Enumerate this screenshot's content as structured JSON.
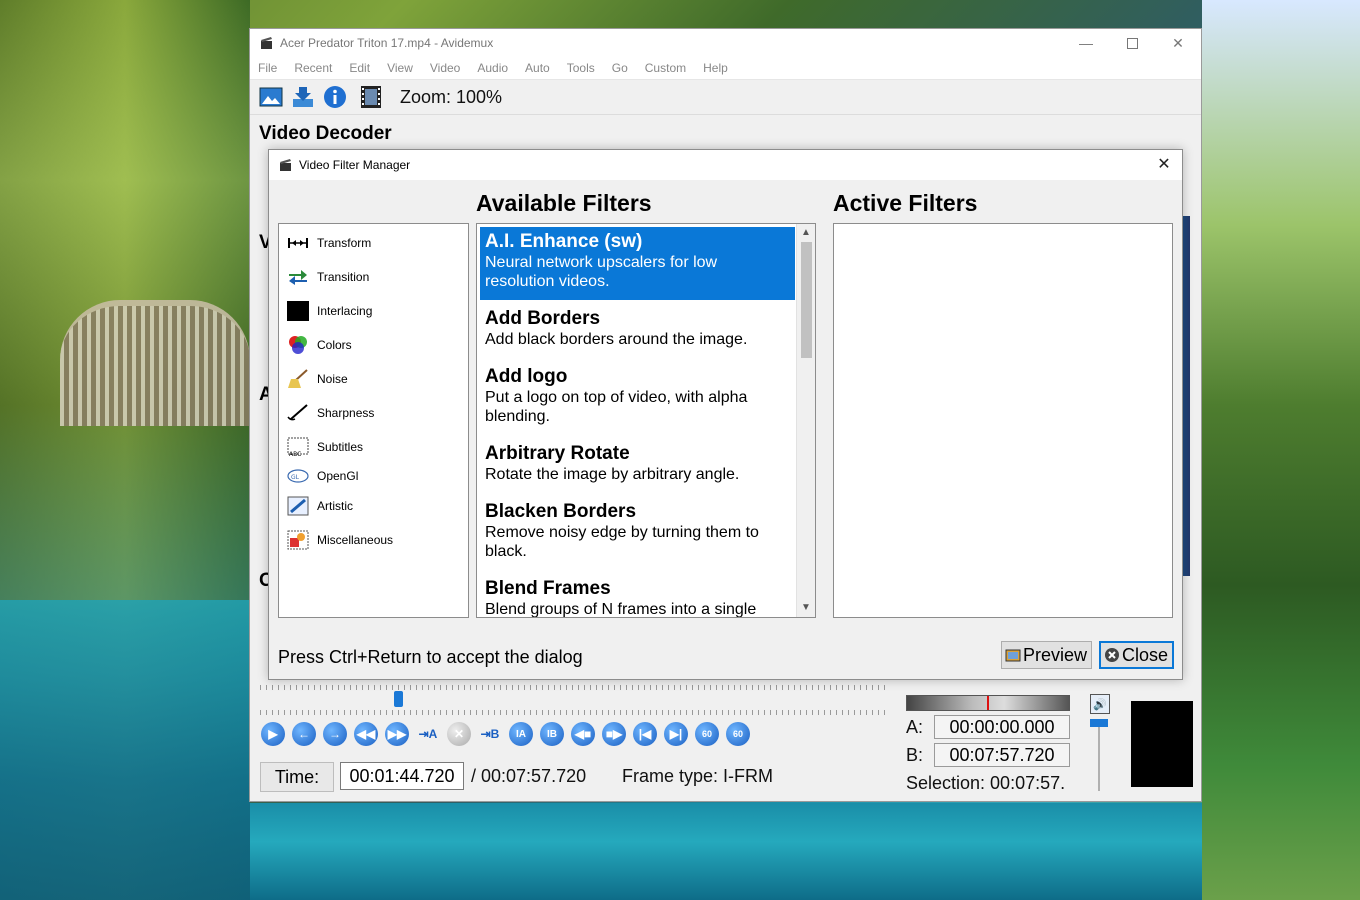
{
  "window": {
    "title": "Acer Predator Triton 17.mp4 - Avidemux",
    "menu": [
      "File",
      "Recent",
      "Edit",
      "View",
      "Video",
      "Audio",
      "Auto",
      "Tools",
      "Go",
      "Custom",
      "Help"
    ],
    "zoom": "Zoom: 100%",
    "section_title": "Video Decoder",
    "side_letters": [
      "V",
      "A",
      "O"
    ]
  },
  "dialog": {
    "title": "Video Filter Manager",
    "available_heading": "Available Filters",
    "active_heading": "Active Filters",
    "categories": [
      {
        "label": "Transform",
        "icon": "transform-icon"
      },
      {
        "label": "Transition",
        "icon": "transition-icon"
      },
      {
        "label": "Interlacing",
        "icon": "interlacing-icon"
      },
      {
        "label": "Colors",
        "icon": "colors-icon"
      },
      {
        "label": "Noise",
        "icon": "noise-icon"
      },
      {
        "label": "Sharpness",
        "icon": "sharpness-icon"
      },
      {
        "label": "Subtitles",
        "icon": "subtitles-icon"
      },
      {
        "label": "OpenGl",
        "icon": "opengl-icon"
      },
      {
        "label": "Artistic",
        "icon": "artistic-icon"
      },
      {
        "label": "Miscellaneous",
        "icon": "miscellaneous-icon"
      }
    ],
    "filters": [
      {
        "name": "A.I. Enhance (sw)",
        "desc": "Neural network upscalers for low resolution videos.",
        "selected": true
      },
      {
        "name": "Add Borders",
        "desc": "Add black borders around the image."
      },
      {
        "name": "Add logo",
        "desc": "Put a logo on top of video, with alpha blending."
      },
      {
        "name": "Arbitrary Rotate",
        "desc": "Rotate the image by arbitrary angle."
      },
      {
        "name": "Blacken Borders",
        "desc": "Remove noisy edge by turning them to black."
      },
      {
        "name": "Blend Frames",
        "desc": "Blend groups of N frames into a single"
      }
    ],
    "hint": "Press Ctrl+Return to accept the dialog",
    "preview_label": "Preview",
    "close_label": "Close"
  },
  "playback": {
    "time_label": "Time:",
    "current_time": "00:01:44.720",
    "total_time": "/ 00:07:57.720",
    "frame_type": "Frame type: I-FRM",
    "a_label": "A:",
    "a_time": "00:00:00.000",
    "b_label": "B:",
    "b_time": "00:07:57.720",
    "selection": "Selection: 00:07:57.",
    "position_fraction": 0.22
  },
  "colors": {
    "accent": "#0a78d7",
    "selection_bg": "#0a78d7"
  }
}
